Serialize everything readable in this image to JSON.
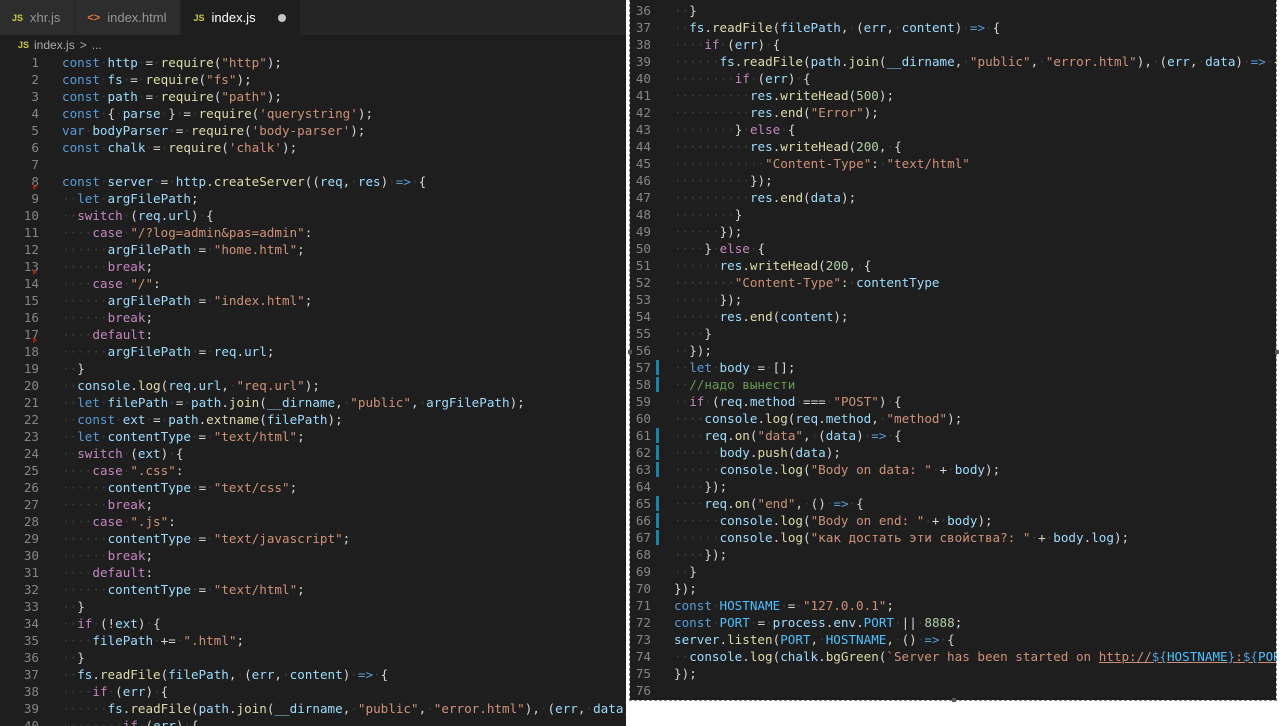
{
  "tabs": [
    {
      "label": "xhr.js",
      "icon": "js-file-icon",
      "active": false
    },
    {
      "label": "index.html",
      "icon": "html-file-icon",
      "active": false
    },
    {
      "label": "index.js",
      "icon": "js-file-icon",
      "active": true,
      "modified": true
    }
  ],
  "breadcrumb": {
    "file": "index.js",
    "separator": ">",
    "more": "..."
  },
  "icons": {
    "js": "JS",
    "html": "<>"
  },
  "colors": {
    "editor_bg": "#1e1e1e",
    "tab_bar": "#252526",
    "gutter_modified": "#1b81a8",
    "gutter_deleted": "#a1260d"
  },
  "left_editor": {
    "lines": [
      {
        "n": "1",
        "code": "const http = require(\"http\");"
      },
      {
        "n": "2",
        "code": "const fs = require(\"fs\");"
      },
      {
        "n": "3",
        "code": "const path = require(\"path\");"
      },
      {
        "n": "4",
        "code": "const { parse } = require('querystring');"
      },
      {
        "n": "5",
        "code": "var bodyParser = require('body-parser');"
      },
      {
        "n": "6",
        "code": "const chalk = require('chalk');"
      },
      {
        "n": "7",
        "code": ""
      },
      {
        "n": "8",
        "code": "const server = http.createServer((req, res) => {",
        "gutter": "deleted"
      },
      {
        "n": "9",
        "code": "  let argFilePath;"
      },
      {
        "n": "10",
        "code": "  switch (req.url) {"
      },
      {
        "n": "11",
        "code": "    case \"/?log=admin&pas=admin\":"
      },
      {
        "n": "12",
        "code": "      argFilePath = \"home.html\";"
      },
      {
        "n": "13",
        "code": "      break;",
        "gutter": "deleted"
      },
      {
        "n": "14",
        "code": "    case \"/\":"
      },
      {
        "n": "15",
        "code": "      argFilePath = \"index.html\";"
      },
      {
        "n": "16",
        "code": "      break;"
      },
      {
        "n": "17",
        "code": "    default:",
        "gutter": "deleted"
      },
      {
        "n": "18",
        "code": "      argFilePath = req.url;"
      },
      {
        "n": "19",
        "code": "  }"
      },
      {
        "n": "20",
        "code": "  console.log(req.url, \"req.url\");"
      },
      {
        "n": "21",
        "code": "  let filePath = path.join(__dirname, \"public\", argFilePath);"
      },
      {
        "n": "22",
        "code": "  const ext = path.extname(filePath);"
      },
      {
        "n": "23",
        "code": "  let contentType = \"text/html\";"
      },
      {
        "n": "24",
        "code": "  switch (ext) {"
      },
      {
        "n": "25",
        "code": "    case \".css\":"
      },
      {
        "n": "26",
        "code": "      contentType = \"text/css\";"
      },
      {
        "n": "27",
        "code": "      break;"
      },
      {
        "n": "28",
        "code": "    case \".js\":"
      },
      {
        "n": "29",
        "code": "      contentType = \"text/javascript\";"
      },
      {
        "n": "30",
        "code": "      break;"
      },
      {
        "n": "31",
        "code": "    default:"
      },
      {
        "n": "32",
        "code": "      contentType = \"text/html\";"
      },
      {
        "n": "33",
        "code": "  }"
      },
      {
        "n": "34",
        "code": "  if (!ext) {"
      },
      {
        "n": "35",
        "code": "    filePath += \".html\";"
      },
      {
        "n": "36",
        "code": "  }"
      },
      {
        "n": "37",
        "code": "  fs.readFile(filePath, (err, content) => {"
      },
      {
        "n": "38",
        "code": "    if (err) {"
      },
      {
        "n": "39",
        "code": "      fs.readFile(path.join(__dirname, \"public\", \"error.html\"), (err, data) => {"
      },
      {
        "n": "40",
        "code": "        if (err) {"
      }
    ]
  },
  "right_editor": {
    "lines": [
      {
        "n": "36",
        "code": "  }"
      },
      {
        "n": "37",
        "code": "  fs.readFile(filePath, (err, content) => {"
      },
      {
        "n": "38",
        "code": "    if (err) {"
      },
      {
        "n": "39",
        "code": "      fs.readFile(path.join(__dirname, \"public\", \"error.html\"), (err, data) => {"
      },
      {
        "n": "40",
        "code": "        if (err) {"
      },
      {
        "n": "41",
        "code": "          res.writeHead(500);"
      },
      {
        "n": "42",
        "code": "          res.end(\"Error\");"
      },
      {
        "n": "43",
        "code": "        } else {"
      },
      {
        "n": "44",
        "code": "          res.writeHead(200, {"
      },
      {
        "n": "45",
        "code": "            \"Content-Type\": \"text/html\""
      },
      {
        "n": "46",
        "code": "          });"
      },
      {
        "n": "47",
        "code": "          res.end(data);"
      },
      {
        "n": "48",
        "code": "        }"
      },
      {
        "n": "49",
        "code": "      });"
      },
      {
        "n": "50",
        "code": "    } else {"
      },
      {
        "n": "51",
        "code": "      res.writeHead(200, {"
      },
      {
        "n": "52",
        "code": "        \"Content-Type\": contentType"
      },
      {
        "n": "53",
        "code": "      });"
      },
      {
        "n": "54",
        "code": "      res.end(content);"
      },
      {
        "n": "55",
        "code": "    }"
      },
      {
        "n": "56",
        "code": "  });"
      },
      {
        "n": "57",
        "code": "  let body = [];",
        "gutter": "modified"
      },
      {
        "n": "58",
        "code": "  //надо вынести",
        "gutter": "modified"
      },
      {
        "n": "59",
        "code": "  if (req.method === \"POST\") {"
      },
      {
        "n": "60",
        "code": "    console.log(req.method, \"method\");"
      },
      {
        "n": "61",
        "code": "    req.on(\"data\", (data) => {",
        "gutter": "modified"
      },
      {
        "n": "62",
        "code": "      body.push(data);",
        "gutter": "modified"
      },
      {
        "n": "63",
        "code": "      console.log(\"Body on data: \" + body);",
        "gutter": "modified"
      },
      {
        "n": "64",
        "code": "    });"
      },
      {
        "n": "65",
        "code": "    req.on(\"end\", () => {",
        "gutter": "modified"
      },
      {
        "n": "66",
        "code": "      console.log(\"Body on end: \" + body);",
        "gutter": "modified"
      },
      {
        "n": "67",
        "code": "      console.log(\"как достать эти свойства?: \" + body.log);",
        "gutter": "modified"
      },
      {
        "n": "68",
        "code": "    });"
      },
      {
        "n": "69",
        "code": "  }"
      },
      {
        "n": "70",
        "code": "});"
      },
      {
        "n": "71",
        "code": "const HOSTNAME = \"127.0.0.1\";"
      },
      {
        "n": "72",
        "code": "const PORT = process.env.PORT || 8888;"
      },
      {
        "n": "73",
        "code": "server.listen(PORT, HOSTNAME, () => {"
      },
      {
        "n": "74",
        "code": "  console.log(chalk.bgGreen(`Server has been started on http://${HOSTNAME}:${PORT}/`));"
      },
      {
        "n": "75",
        "code": "});"
      },
      {
        "n": "76",
        "code": ""
      }
    ]
  }
}
